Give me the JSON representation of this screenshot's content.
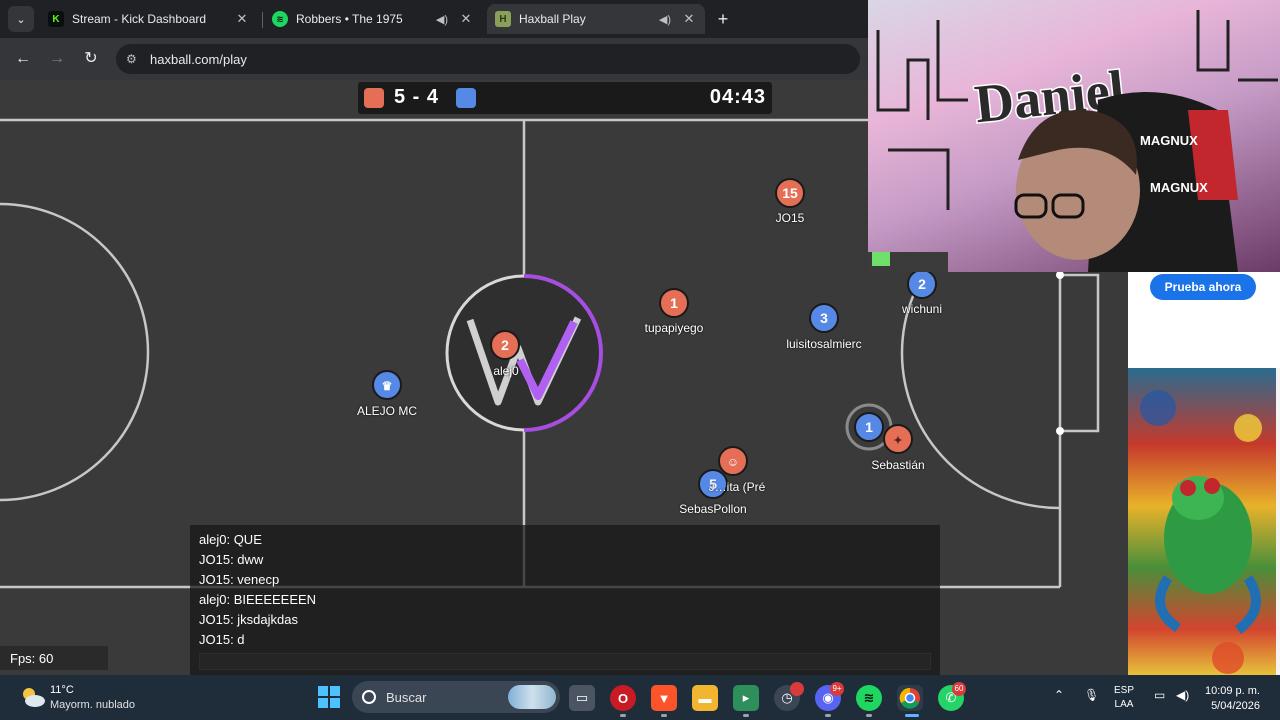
{
  "browser": {
    "tabs": [
      {
        "title": "Stream - Kick Dashboard",
        "favicon": "K",
        "favicon_color": "#53fc18",
        "active": false,
        "audio": false
      },
      {
        "title": "Robbers • The 1975",
        "favicon": "spotify",
        "favicon_color": "#1ed760",
        "active": false,
        "audio": true
      },
      {
        "title": "Haxball Play",
        "favicon": "H",
        "favicon_color": "#8aa05a",
        "active": true,
        "audio": true
      }
    ],
    "url": "haxball.com/play",
    "icons": {
      "back": "arrow-left-icon",
      "forward": "arrow-right-icon",
      "reload": "reload-icon",
      "site_info": "tune-icon",
      "new_tab": "plus-icon",
      "tab_search": "chevron-down-icon"
    }
  },
  "game": {
    "score": "5 - 4",
    "time": "04:43",
    "red_color": "#e56e56",
    "blue_color": "#5689e5",
    "players": [
      {
        "team": "red",
        "number": "15",
        "name": "JO15"
      },
      {
        "team": "red",
        "number": "1",
        "name": "tupapiyego"
      },
      {
        "team": "red",
        "number": "2",
        "name": "alej0"
      },
      {
        "team": "red",
        "number": "",
        "name": "",
        "avatar": "emoji-icon"
      },
      {
        "team": "red",
        "number": "",
        "name": "Sebastián",
        "avatar": "emoji-icon"
      },
      {
        "team": "blue",
        "number": "2",
        "name": "wichuni"
      },
      {
        "team": "blue",
        "number": "3",
        "name": "luisitosalmierc"
      },
      {
        "team": "blue",
        "number": "",
        "name": "ALEJO MC",
        "avatar": "crown-icon"
      },
      {
        "team": "blue",
        "number": "1",
        "name": ""
      },
      {
        "team": "blue",
        "number": "5",
        "name": "SebasPollon"
      }
    ],
    "partial_name": "J…ita (Pré",
    "fps": "Fps: 60"
  },
  "chat": {
    "messages": [
      "alej0: QUE",
      "JO15: dww",
      "JO15: venecp",
      "alej0: BIEEEEEEEN",
      "JO15: jksdajkdas",
      "JO15: d"
    ],
    "input_value": ""
  },
  "overlay": {
    "ad_button": "Prueba ahora",
    "cam_brand": "MAGNUX",
    "cam_graffiti": "Daniel"
  },
  "taskbar": {
    "weather_temp": "11°C",
    "weather_desc": "Mayorm. nublado",
    "search_placeholder": "Buscar",
    "lang_line1": "ESP",
    "lang_line2": "LAA",
    "time": "10:09 p. m.",
    "date": "5/04/2026",
    "whatsapp_badge": "60",
    "discord_badge": "9+"
  }
}
